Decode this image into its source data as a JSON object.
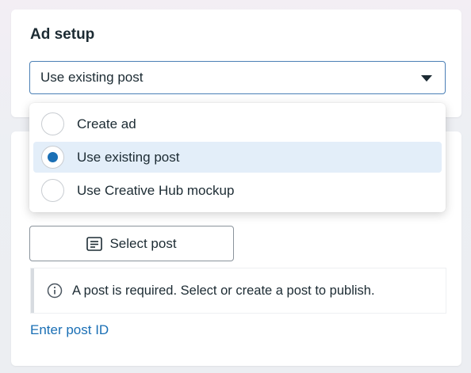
{
  "ad_setup": {
    "title": "Ad setup",
    "select_value": "Use existing post",
    "options": [
      {
        "label": "Create ad",
        "selected": false
      },
      {
        "label": "Use existing post",
        "selected": true
      },
      {
        "label": "Use Creative Hub mockup",
        "selected": false
      }
    ]
  },
  "post": {
    "select_button_label": "Select post",
    "notice_text": "A post is required. Select or create a post to publish.",
    "enter_id_link": "Enter post ID"
  },
  "colors": {
    "accent": "#1a6fb5",
    "selected_row": "#e3eef9",
    "select_border": "#4a7fb5"
  },
  "icons": {
    "dropdown": "caret-down-icon",
    "select_button": "document-icon",
    "notice": "info-icon"
  }
}
